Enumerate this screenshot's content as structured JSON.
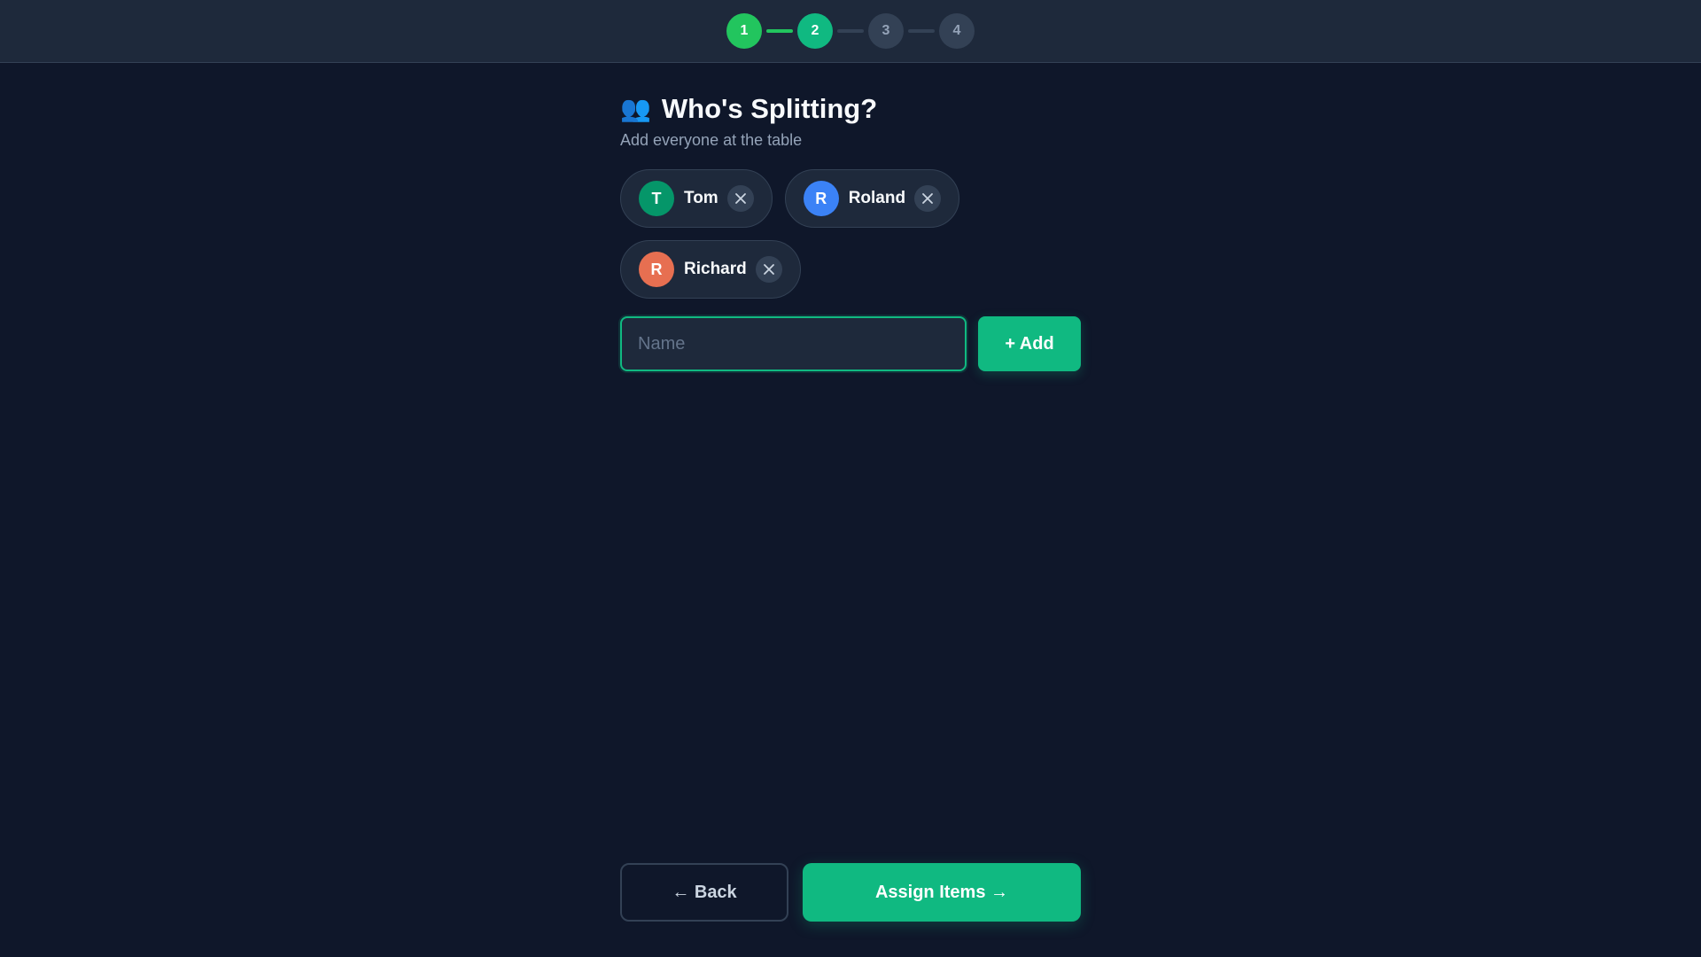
{
  "stepper": {
    "steps": [
      {
        "label": "1",
        "state": "done"
      },
      {
        "label": "2",
        "state": "active"
      },
      {
        "label": "3",
        "state": "todo"
      },
      {
        "label": "4",
        "state": "todo"
      }
    ]
  },
  "header": {
    "icon": "people-icon",
    "icon_glyph": "👥",
    "title": "Who's Splitting?",
    "subtitle": "Add everyone at the table"
  },
  "people": [
    {
      "initial": "T",
      "name": "Tom",
      "color": "#059669"
    },
    {
      "initial": "R",
      "name": "Roland",
      "color": "#3b82f6"
    },
    {
      "initial": "R",
      "name": "Richard",
      "color": "#e76f51"
    }
  ],
  "add_person": {
    "placeholder": "Name",
    "value": "",
    "button_label": "+ Add"
  },
  "footer": {
    "back_label": "← Back",
    "next_label": "Assign Items →"
  },
  "colors": {
    "background": "#0f172a",
    "surface": "#1e293b",
    "accent": "#10b981",
    "done": "#22c55e"
  }
}
